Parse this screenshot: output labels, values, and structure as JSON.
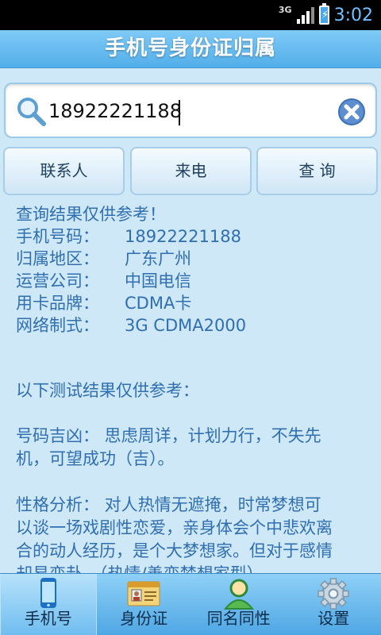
{
  "status_bar": {
    "network": "3G",
    "time": "3:02"
  },
  "title": "手机号身份证归属",
  "search": {
    "value": "18922221188"
  },
  "buttons": {
    "contacts": "联系人",
    "calls": "来电",
    "query": "查 询"
  },
  "results": {
    "notice": "查询结果仅供参考！",
    "fields": [
      {
        "key": "手机号码：",
        "value": "18922221188"
      },
      {
        "key": "归属地区：",
        "value": "广东广州"
      },
      {
        "key": "运营公司：",
        "value": "中国电信"
      },
      {
        "key": "用卡品牌：",
        "value": "CDMA卡"
      },
      {
        "key": "网络制式：",
        "value": "3G CDMA2000"
      }
    ],
    "test_notice": "以下测试结果仅供参考：",
    "luck_line1": "号码吉凶：  思虑周详，计划力行，不失先",
    "luck_line2": "机，可望成功（吉）。",
    "personality_line1": "性格分析：  对人热情无遮掩，时常梦想可",
    "personality_line2": "以谈一场戏剧性恋爱，亲身体会个中悲欢离",
    "personality_line3": "合的动人经历，是个大梦想家。但对于感情",
    "personality_line4": "却易变卦。（热情/善变梦想家型）"
  },
  "tabs": [
    {
      "label": "手机号",
      "icon": "phone-icon",
      "active": true
    },
    {
      "label": "身份证",
      "icon": "id-card-icon",
      "active": false
    },
    {
      "label": "同名同性",
      "icon": "person-icon",
      "active": false
    },
    {
      "label": "设置",
      "icon": "gear-icon",
      "active": false
    }
  ],
  "colors": {
    "accent": "#52aee9",
    "result_text": "#2f6fb0",
    "background": "#cfe8f8"
  }
}
